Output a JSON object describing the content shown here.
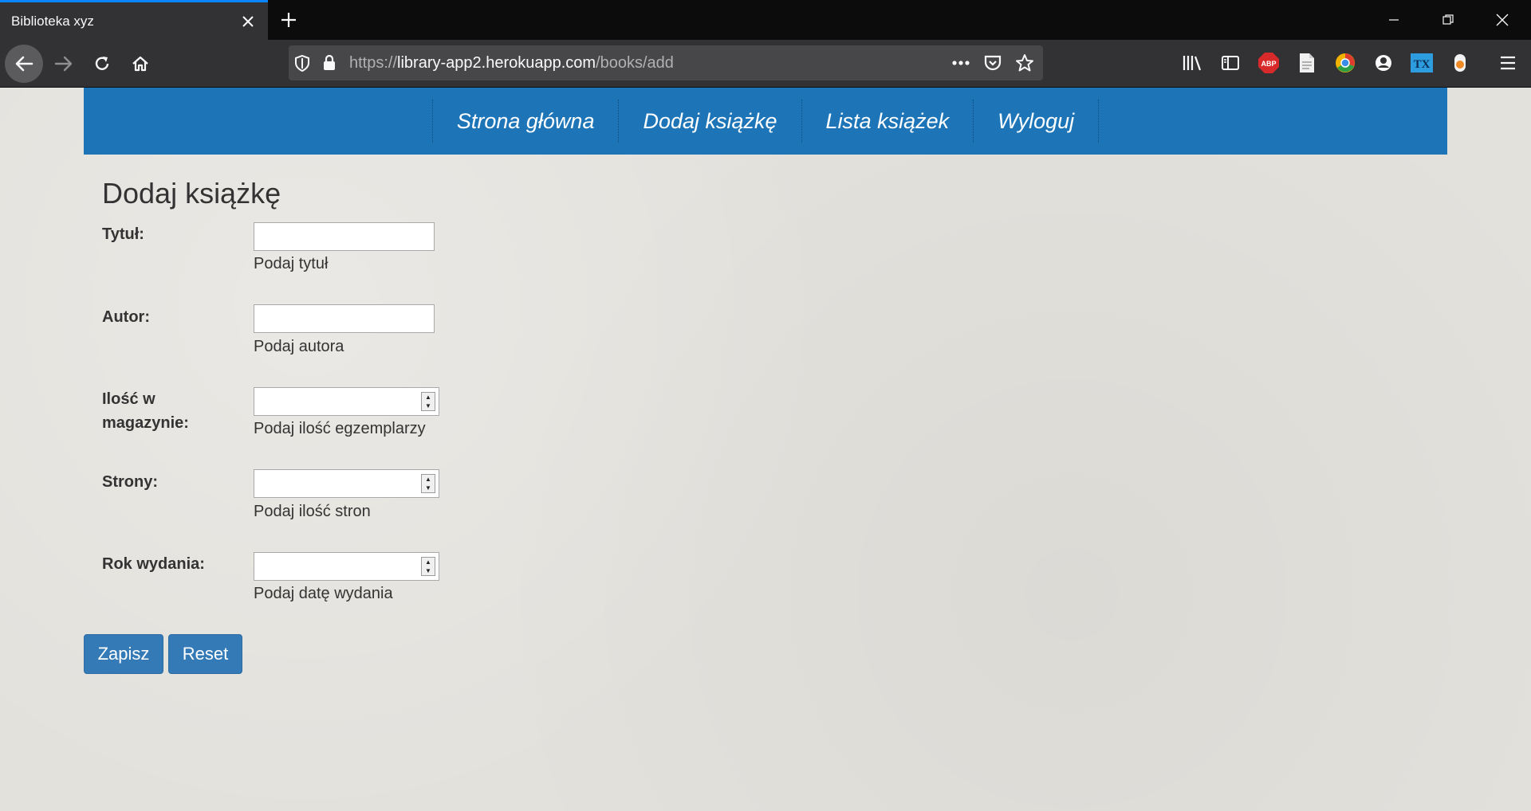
{
  "browser": {
    "tab_title": "Biblioteka xyz",
    "url_scheme": "https://",
    "url_host": "library-app2.herokuapp.com",
    "url_path": "/books/add",
    "icons": {
      "tab_close": "close-icon",
      "new_tab": "plus-icon",
      "back": "arrow-left-icon",
      "forward": "arrow-right-icon",
      "reload": "reload-icon",
      "home": "home-icon",
      "shield": "shield-icon",
      "lock": "lock-icon",
      "more": "ellipsis-icon",
      "pocket": "pocket-icon",
      "bookmark": "star-icon",
      "library": "library-icon",
      "sidebar": "sidebar-icon",
      "abp": "adblock-icon",
      "document": "document-icon",
      "chrome_ext": "colorful-circle-icon",
      "account": "account-icon",
      "tx": "tx-extension-icon",
      "orange_ext": "orange-extension-icon",
      "menu": "hamburger-menu-icon"
    },
    "abp_label": "ABP",
    "tx_label": "TX"
  },
  "nav": {
    "items": [
      "Strona główna",
      "Dodaj książkę",
      "Lista książek",
      "Wyloguj"
    ]
  },
  "form": {
    "heading": "Dodaj książkę",
    "fields": [
      {
        "label": "Tytuł:",
        "help": "Podaj tytuł",
        "value": ""
      },
      {
        "label": "Autor:",
        "help": "Podaj autora",
        "value": ""
      },
      {
        "label_line1": "Ilość w",
        "label_line2": "magazynie:",
        "help": "Podaj ilość egzemplarzy",
        "value": ""
      },
      {
        "label": "Strony:",
        "help": "Podaj ilość stron",
        "value": ""
      },
      {
        "label": "Rok wydania:",
        "help": "Podaj datę wydania",
        "value": ""
      }
    ],
    "save_label": "Zapisz",
    "reset_label": "Reset"
  },
  "colors": {
    "navbar": "#1d75b8",
    "button": "#337ab7",
    "page_bg": "#e3e1dc",
    "tab_accent": "#0a84ff"
  }
}
